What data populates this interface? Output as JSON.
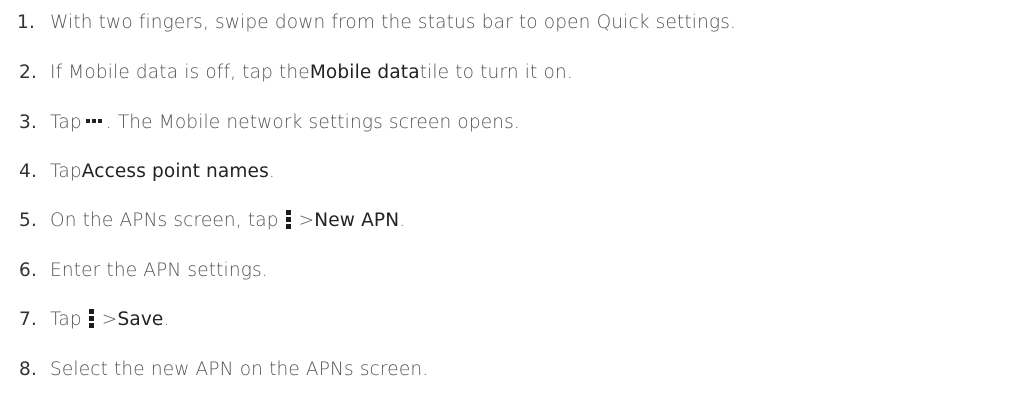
{
  "steps": [
    {
      "number": "1.",
      "text": "With two fingers, swipe down from the status bar to open Quick settings."
    },
    {
      "number": "2.",
      "text_before": "If Mobile data is off, tap the ",
      "bold": "Mobile data",
      "text_after": " tile to turn it on."
    },
    {
      "number": "3.",
      "text_before": "Tap ",
      "icon": "more-horizontal-icon",
      "text_after": ". The Mobile network settings screen opens."
    },
    {
      "number": "4.",
      "text_before": "Tap ",
      "bold": "Access point names",
      "text_after": "."
    },
    {
      "number": "5.",
      "text_before": "On the APNs screen, tap ",
      "icon": "kebab-menu-icon",
      "separator": "> ",
      "bold": "New APN",
      "text_after": "."
    },
    {
      "number": "6.",
      "text": "Enter the APN settings."
    },
    {
      "number": "7.",
      "text_before": "Tap ",
      "icon": "kebab-menu-icon",
      "separator": "> ",
      "bold": "Save",
      "text_after": "."
    },
    {
      "number": "8.",
      "text": "Select the new APN on the APNs screen."
    }
  ]
}
